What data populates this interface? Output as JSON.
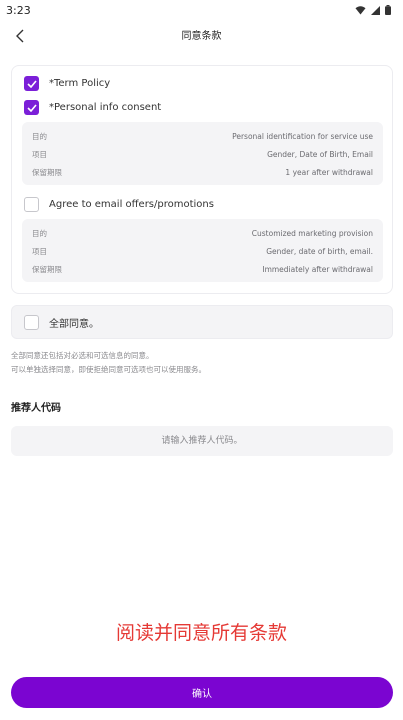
{
  "status_bar": {
    "time": "3:23",
    "icons": [
      "wifi-icon",
      "signal-icon",
      "battery-icon"
    ]
  },
  "header": {
    "back_icon": "chevron-left-icon",
    "title": "同意条款"
  },
  "consents": {
    "term_policy": {
      "label": "*Term Policy",
      "checked": true
    },
    "personal_info": {
      "label": "*Personal info consent",
      "checked": true,
      "details": [
        {
          "key": "目的",
          "value": "Personal identification for service use"
        },
        {
          "key": "项目",
          "value": "Gender, Date of Birth, Email"
        },
        {
          "key": "保留期限",
          "value": "1 year after withdrawal"
        }
      ]
    },
    "email_offers": {
      "label": "Agree to email offers/promotions",
      "checked": false,
      "details": [
        {
          "key": "目的",
          "value": "Customized marketing provision"
        },
        {
          "key": "项目",
          "value": "Gender, date of birth, email."
        },
        {
          "key": "保留期限",
          "value": "Immediately after withdrawal"
        }
      ]
    }
  },
  "agree_all": {
    "label": "全部同意。",
    "checked": false
  },
  "notes": {
    "line1": "全部同意还包括对必选和可选信息的同意。",
    "line2": "可以单独选择同意，即使拒绝同意可选项也可以使用服务。"
  },
  "referral": {
    "title": "推荐人代码",
    "placeholder": "请输入推荐人代码。",
    "value": ""
  },
  "overlay_text": "阅读并同意所有条款",
  "confirm_button": "确认",
  "colors": {
    "accent": "#7b05d1",
    "checkbox_checked": "#7b1fd8",
    "overlay_text": "#e53935",
    "panel_bg": "#f4f4f6"
  }
}
